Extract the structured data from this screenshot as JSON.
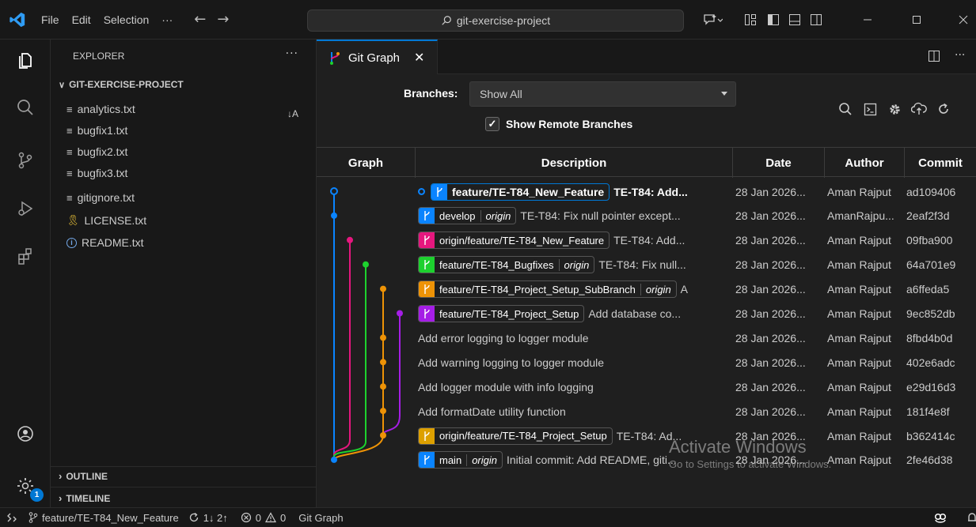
{
  "title_bar": {
    "menus": [
      "File",
      "Edit",
      "Selection"
    ],
    "more": "···",
    "search_text": "git-exercise-project"
  },
  "sidebar": {
    "title": "EXPLORER",
    "more": "···",
    "project": "GIT-EXERCISE-PROJECT",
    "sort_indicator": "↓A",
    "files": [
      {
        "name": "analytics.txt",
        "icon": "text-file-icon"
      },
      {
        "name": "bugfix1.txt",
        "icon": "text-file-icon"
      },
      {
        "name": "bugfix2.txt",
        "icon": "text-file-icon"
      },
      {
        "name": "bugfix3.txt",
        "icon": "text-file-icon"
      },
      {
        "name": "gitignore.txt",
        "icon": "text-file-icon"
      },
      {
        "name": "LICENSE.txt",
        "icon": "license-icon"
      },
      {
        "name": "README.txt",
        "icon": "info-icon"
      }
    ],
    "outline": "OUTLINE",
    "timeline": "TIMELINE"
  },
  "activity_badge": "1",
  "editor": {
    "tab_label": "Git Graph",
    "branches_label": "Branches:",
    "branches_value": "Show All",
    "remote_label": "Show Remote Branches",
    "remote_checked": true,
    "columns": [
      "Graph",
      "Description",
      "Date",
      "Author",
      "Commit"
    ],
    "colors": {
      "blue": "#0a84ff",
      "pink": "#e5177e",
      "green": "#1dd12e",
      "orange": "#ee9306",
      "purple": "#a51ee6",
      "yellow": "#dda000"
    },
    "rows": [
      {
        "head": true,
        "ref": "feature/TE-T84_New_Feature",
        "remote": "",
        "ref_color": "#0a84ff",
        "message": "TE-T84: Add...",
        "bold": true,
        "date": "28 Jan 2026...",
        "author": "Aman Rajput",
        "commit": "ad109406"
      },
      {
        "head": false,
        "ref": "develop",
        "remote": "origin",
        "ref_color": "#0a84ff",
        "message": "TE-T84: Fix null pointer except...",
        "bold": false,
        "date": "28 Jan 2026...",
        "author": "AmanRajpu...",
        "commit": "2eaf2f3d"
      },
      {
        "head": false,
        "ref": "origin/feature/TE-T84_New_Feature",
        "remote": "",
        "ref_color": "#e5177e",
        "message": "TE-T84: Add...",
        "bold": false,
        "date": "28 Jan 2026...",
        "author": "Aman Rajput",
        "commit": "09fba900"
      },
      {
        "head": false,
        "ref": "feature/TE-T84_Bugfixes",
        "remote": "origin",
        "ref_color": "#1dd12e",
        "message": "TE-T84: Fix null...",
        "bold": false,
        "date": "28 Jan 2026...",
        "author": "Aman Rajput",
        "commit": "64a701e9"
      },
      {
        "head": false,
        "ref": "feature/TE-T84_Project_Setup_SubBranch",
        "remote": "origin",
        "ref_color": "#ee9306",
        "message": "A",
        "bold": false,
        "date": "28 Jan 2026...",
        "author": "Aman Rajput",
        "commit": "a6ffeda5"
      },
      {
        "head": false,
        "ref": "feature/TE-T84_Project_Setup",
        "remote": "",
        "ref_color": "#a51ee6",
        "message": "Add database co...",
        "bold": false,
        "date": "28 Jan 2026...",
        "author": "Aman Rajput",
        "commit": "9ec852db"
      },
      {
        "head": false,
        "ref": "",
        "remote": "",
        "ref_color": "",
        "message": "Add error logging to logger module",
        "bold": false,
        "date": "28 Jan 2026...",
        "author": "Aman Rajput",
        "commit": "8fbd4b0d"
      },
      {
        "head": false,
        "ref": "",
        "remote": "",
        "ref_color": "",
        "message": "Add warning logging to logger module",
        "bold": false,
        "date": "28 Jan 2026...",
        "author": "Aman Rajput",
        "commit": "402e6adc"
      },
      {
        "head": false,
        "ref": "",
        "remote": "",
        "ref_color": "",
        "message": "Add logger module with info logging",
        "bold": false,
        "date": "28 Jan 2026...",
        "author": "Aman Rajput",
        "commit": "e29d16d3"
      },
      {
        "head": false,
        "ref": "",
        "remote": "",
        "ref_color": "",
        "message": "Add formatDate utility function",
        "bold": false,
        "date": "28 Jan 2026...",
        "author": "Aman Rajput",
        "commit": "181f4e8f"
      },
      {
        "head": false,
        "ref": "origin/feature/TE-T84_Project_Setup",
        "remote": "",
        "ref_color": "#dda000",
        "message": "TE-T84: Ad...",
        "bold": false,
        "date": "28 Jan 2026...",
        "author": "Aman Rajput",
        "commit": "b362414c"
      },
      {
        "head": false,
        "ref": "main",
        "remote": "origin",
        "ref_color": "#0a84ff",
        "message": "Initial commit: Add README, giti...",
        "bold": false,
        "date": "28 Jan 2026...",
        "author": "Aman Rajput",
        "commit": "2fe46d38"
      }
    ]
  },
  "watermark": {
    "title": "Activate Windows",
    "subtitle": "Go to Settings to activate Windows."
  },
  "status_bar": {
    "branch": "feature/TE-T84_New_Feature",
    "sync": "1↓ 2↑",
    "errors": "0",
    "warnings": "0",
    "extension": "Git Graph"
  }
}
